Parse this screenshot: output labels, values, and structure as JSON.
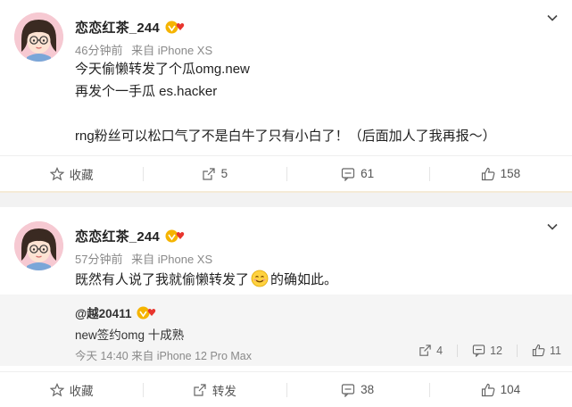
{
  "colors": {
    "separator": "#f2f2f2",
    "text": "#222222",
    "meta": "#8a8a8a",
    "quote_bg": "#f5f5f5",
    "badge_gold": "#f5b400",
    "badge_red": "#e8352e"
  },
  "posts": [
    {
      "username": "恋恋红茶_244",
      "time": "46分钟前",
      "source": "来自 iPhone XS",
      "lines": [
        "今天偷懒转发了个瓜omg.new",
        "再发个一手瓜 es.hacker",
        "rng粉丝可以松口气了不是白牛了只有小白了！（后面加人了我再报～）"
      ],
      "actions": {
        "favorite": "收藏",
        "repost": "5",
        "comment": "61",
        "like": "158"
      }
    },
    {
      "username": "恋恋红茶_244",
      "time": "57分钟前",
      "source": "来自 iPhone XS",
      "text_before": "既然有人说了我就偷懒转发了",
      "text_after": "的确如此。",
      "quoted": {
        "user": "@越20411",
        "text": "new签约omg 十成熟",
        "meta": "今天 14:40 来自 iPhone 12 Pro Max",
        "repost": "4",
        "comment": "12",
        "like": "11"
      },
      "actions": {
        "favorite": "收藏",
        "repost": "转发",
        "comment": "38",
        "like": "104"
      }
    }
  ]
}
